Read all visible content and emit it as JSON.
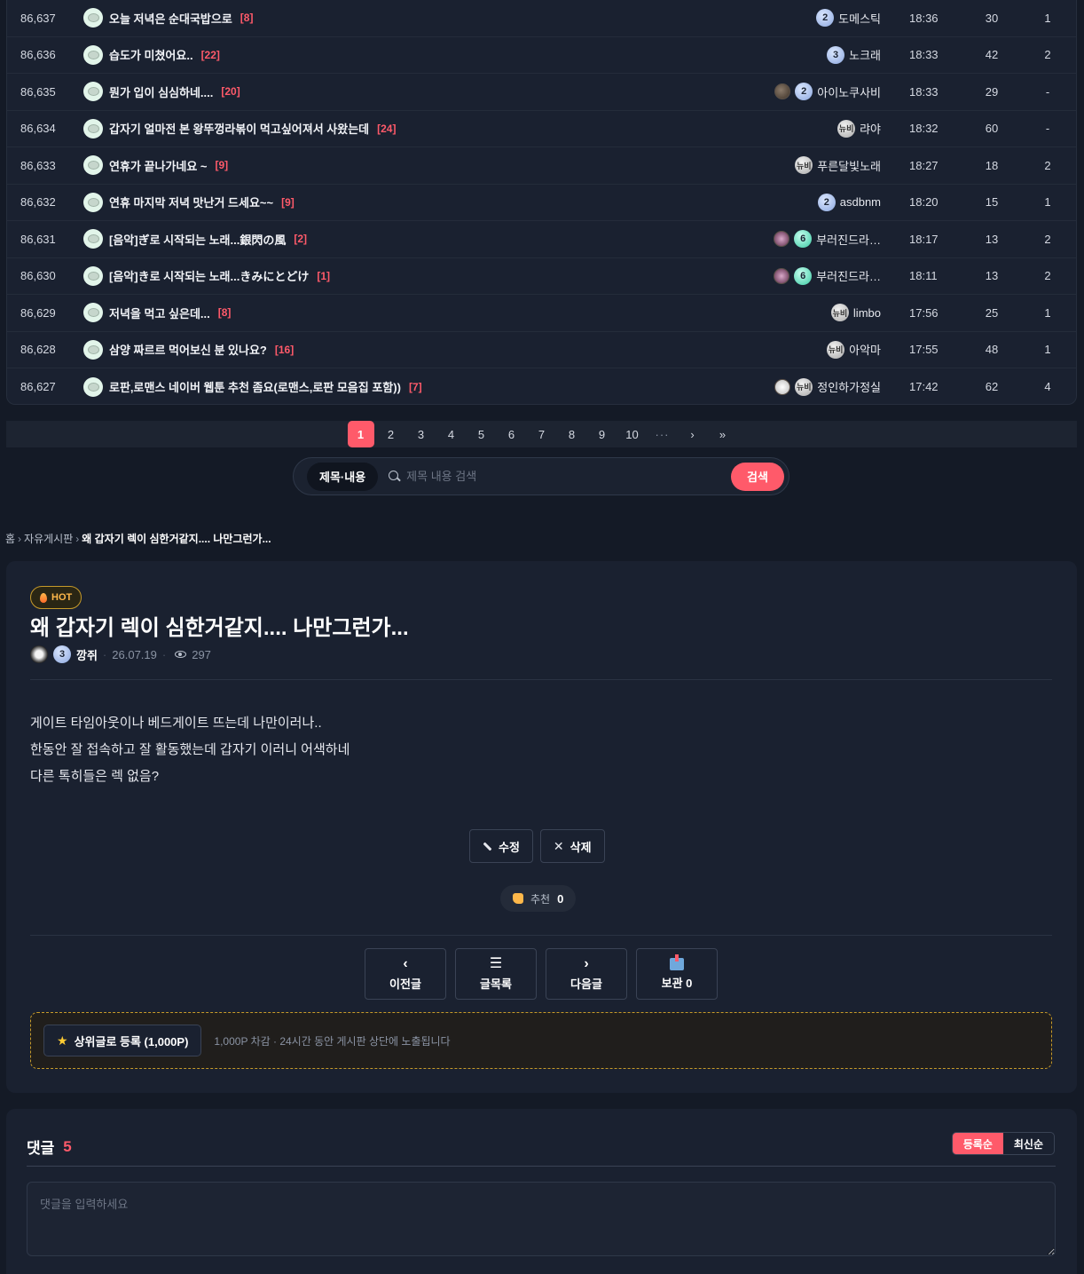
{
  "board": {
    "rows": [
      {
        "num": "86,637",
        "title": "오늘 저녁은 순대국밥으로",
        "comments": "[8]",
        "author": "도메스틱",
        "level": "2",
        "time": "18:36",
        "views": "30",
        "rec": "1"
      },
      {
        "num": "86,636",
        "title": "습도가 미쳤어요..",
        "comments": "[22]",
        "author": "노크래",
        "level": "3",
        "time": "18:33",
        "views": "42",
        "rec": "2"
      },
      {
        "num": "86,635",
        "title": "뭔가 입이 심심하네....",
        "comments": "[20]",
        "author": "아이노쿠사비",
        "level": "2",
        "time": "18:33",
        "views": "29",
        "rec": "-"
      },
      {
        "num": "86,634",
        "title": "갑자기 얼마전 본 왕뚜껑라볶이 먹고싶어져서 사왔는데",
        "comments": "[24]",
        "author": "랴야",
        "level": "뉴비",
        "time": "18:32",
        "views": "60",
        "rec": "-"
      },
      {
        "num": "86,633",
        "title": "연휴가 끝나가네요 ~",
        "comments": "[9]",
        "author": "푸른달빛노래",
        "level": "뉴비",
        "time": "18:27",
        "views": "18",
        "rec": "2"
      },
      {
        "num": "86,632",
        "title": "연휴 마지막 저녁 맛난거 드세요~~",
        "comments": "[9]",
        "author": "asdbnm",
        "level": "2",
        "time": "18:20",
        "views": "15",
        "rec": "1"
      },
      {
        "num": "86,631",
        "title": "[음악]ぎ로 시작되는 노래...銀閃の風",
        "comments": "[2]",
        "author": "부러진드라…",
        "level": "6",
        "time": "18:17",
        "views": "13",
        "rec": "2"
      },
      {
        "num": "86,630",
        "title": "[음악]き로 시작되는 노래...きみにとどけ",
        "comments": "[1]",
        "author": "부러진드라…",
        "level": "6",
        "time": "18:11",
        "views": "13",
        "rec": "2"
      },
      {
        "num": "86,629",
        "title": "저녁을 먹고 싶은데...",
        "comments": "[8]",
        "author": "limbo",
        "level": "뉴비",
        "time": "17:56",
        "views": "25",
        "rec": "1"
      },
      {
        "num": "86,628",
        "title": "삼양 짜르르 먹어보신 분 있나요?",
        "comments": "[16]",
        "author": "아악마",
        "level": "뉴비",
        "time": "17:55",
        "views": "48",
        "rec": "1"
      },
      {
        "num": "86,627",
        "title": "로판,로맨스 네이버 웹툰 추천 좀요(로맨스,로판 모음집 포함))",
        "comments": "[7]",
        "author": "정인하가정실",
        "level": "뉴비",
        "time": "17:42",
        "views": "62",
        "rec": "4"
      }
    ]
  },
  "pagination": {
    "pages": [
      "1",
      "2",
      "3",
      "4",
      "5",
      "6",
      "7",
      "8",
      "9",
      "10"
    ],
    "dots": "···",
    "next": "›",
    "last": "»"
  },
  "search": {
    "type": "제목·내용",
    "placeholder": "제목 내용 검색",
    "button": "검색"
  },
  "breadcrumb": {
    "home": "홈",
    "board": "자유게시판",
    "current": "왜 갑자기 렉이 심한거같지.... 나만그런가..."
  },
  "post": {
    "badge": "HOT",
    "title": "왜 갑자기 렉이 심한거같지.... 나만그런가...",
    "author_level": "3",
    "author": "깡쥐",
    "date": "26.07.19",
    "views": "297",
    "body": [
      "게이트 타임아웃이나 베드게이트 뜨는데 나만이러나..",
      "한동안 잘 접속하고 잘 활동했는데 갑자기 이러니 어색하네",
      "다른 톡히들은 렉 없음?"
    ],
    "edit_label": "수정",
    "delete_label": "삭제",
    "like_label": "추천",
    "like_count": "0",
    "nav": {
      "prev": "이전글",
      "list": "글목록",
      "next": "다음글",
      "save": "보관 0"
    },
    "promo": {
      "button": "상위글로 등록 (1,000P)",
      "desc": "1,000P 차감 · 24시간 동안 게시판 상단에 노출됩니다"
    }
  },
  "comments": {
    "label": "댓글",
    "count": "5",
    "sort_oldest": "등록순",
    "sort_newest": "최신순",
    "placeholder": "댓글을 입력하세요"
  },
  "colors": {
    "accent": "#ff5a6a",
    "background": "#141a26",
    "panel": "#1a2130",
    "hot": "#c69a2a"
  }
}
